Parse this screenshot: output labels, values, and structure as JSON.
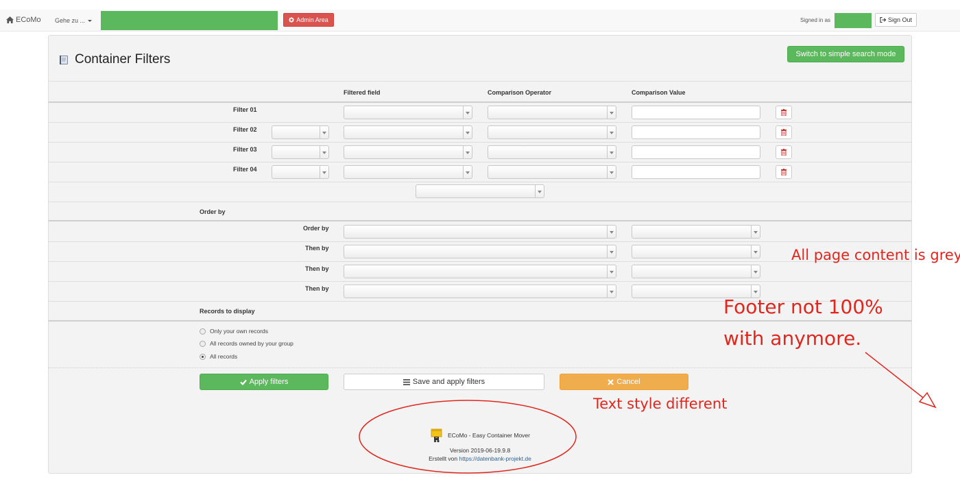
{
  "navbar": {
    "brand": "ECoMo",
    "goto_label": "Gehe zu ...",
    "admin_label": "Admin Area",
    "signed_in_label": "Signed in as",
    "signout_label": "Sign Out"
  },
  "header": {
    "title": "Container Filters",
    "simple_mode_label": "Switch to simple search mode"
  },
  "filters": {
    "columns": [
      "Filtered field",
      "Comparison Operator",
      "Comparison Value"
    ],
    "rows": [
      {
        "label": "Filter 01"
      },
      {
        "label": "Filter 02"
      },
      {
        "label": "Filter 03"
      },
      {
        "label": "Filter 04"
      }
    ]
  },
  "order": {
    "section_label": "Order by",
    "rows": [
      {
        "label": "Order by"
      },
      {
        "label": "Then by"
      },
      {
        "label": "Then by"
      },
      {
        "label": "Then by"
      }
    ]
  },
  "records": {
    "section_label": "Records to display",
    "options": [
      {
        "label": "Only your own records",
        "checked": false
      },
      {
        "label": "All records owned by your group",
        "checked": false
      },
      {
        "label": "All records",
        "checked": true
      }
    ]
  },
  "actions": {
    "apply_label": "Apply filters",
    "save_label": "Save and apply filters",
    "cancel_label": "Cancel"
  },
  "footer": {
    "title": "ECoMo - Easy Container Mover",
    "version": "Version 2019-06-19.9.8",
    "created_by": "Erstellt von",
    "link": "https://datenbank-projekt.de"
  },
  "annotations": {
    "grey": "All page content is grey",
    "footer_line1": "Footer not 100%",
    "footer_line2": "with anymore.",
    "text_style": "Text style different"
  },
  "colors": {
    "success": "#5cb85c",
    "danger": "#d9534f",
    "warning": "#f0ad4e",
    "annotation": "#e0261d"
  }
}
